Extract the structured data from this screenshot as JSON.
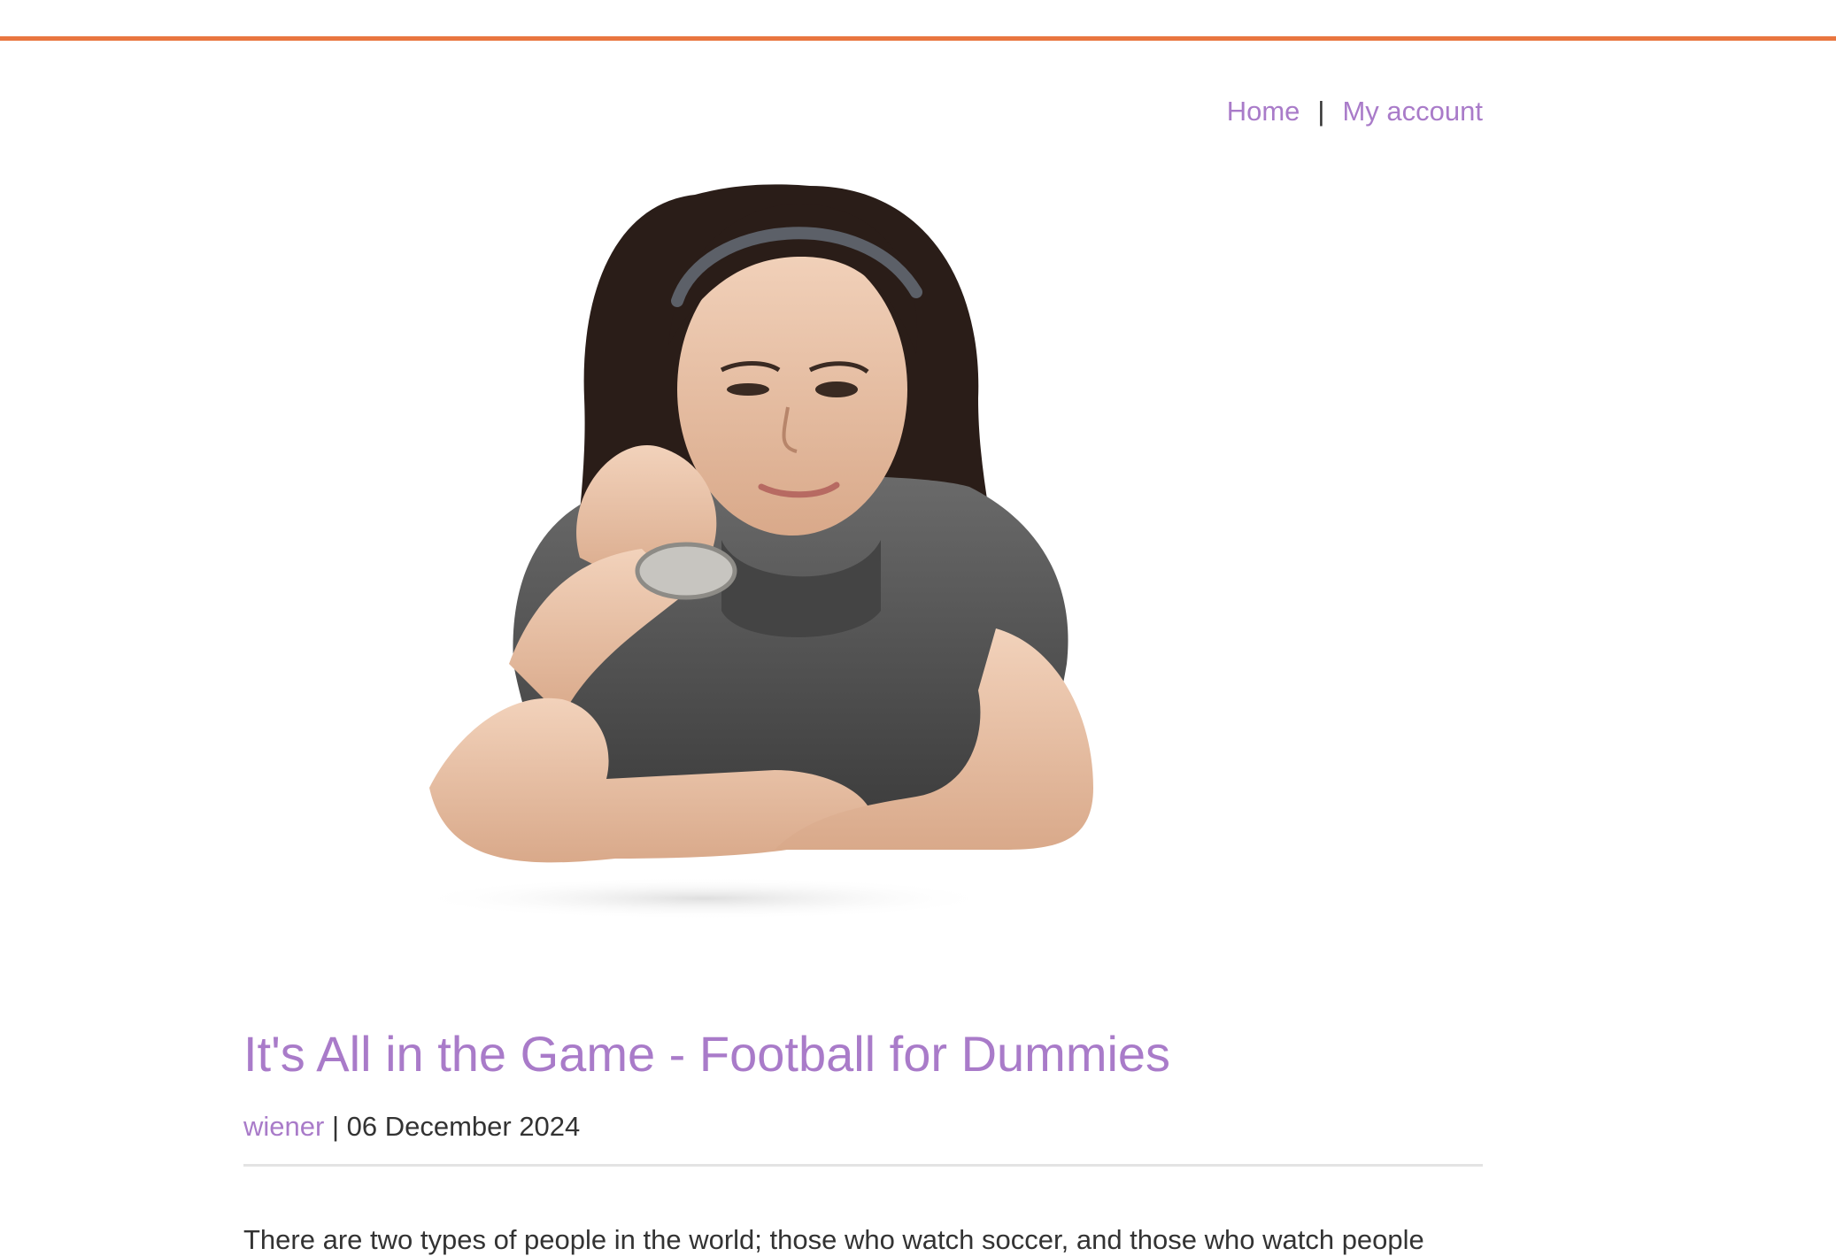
{
  "colors": {
    "accent": "#e97640",
    "link": "#a97bc9",
    "text": "#333333"
  },
  "nav": {
    "home_label": "Home",
    "separator": "|",
    "account_label": "My account"
  },
  "post": {
    "title": "It's All in the Game - Football for Dummies",
    "author": "wiener",
    "date_separator": " | ",
    "date": "06 December 2024",
    "intro": "There are two types of people in the world; those who watch soccer, and those who watch people"
  }
}
